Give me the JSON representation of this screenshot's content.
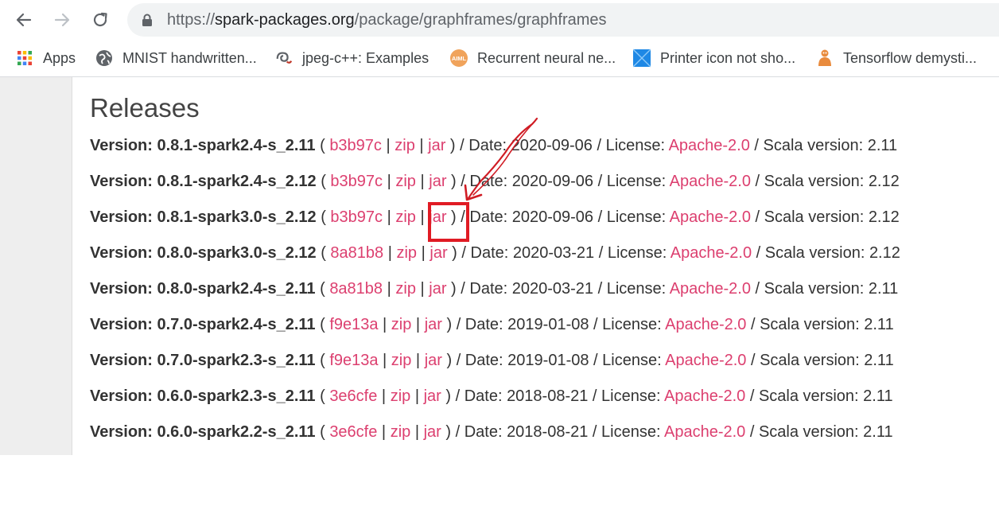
{
  "browser": {
    "url": "https://spark-packages.org/package/graphframes/graphframes",
    "url_scheme": "https://",
    "url_host": "spark-packages.org",
    "url_path": "/package/graphframes/graphframes"
  },
  "bookmarks": [
    {
      "label": "Apps",
      "icon": "apps-grid-icon"
    },
    {
      "label": "MNIST handwritten...",
      "icon": "globe-icon"
    },
    {
      "label": "jpeg-c++: Examples",
      "icon": "spiral-icon"
    },
    {
      "label": "Recurrent neural ne...",
      "icon": "aiml-icon"
    },
    {
      "label": "Printer icon not sho...",
      "icon": "windows-icon"
    },
    {
      "label": "Tensorflow demysti...",
      "icon": "tensorflow-icon"
    }
  ],
  "page": {
    "heading": "Releases",
    "labels": {
      "version_prefix": "Version: ",
      "date_prefix": " / Date: ",
      "license_prefix": " / License: ",
      "scala_prefix": " / Scala version: ",
      "open_paren": " ( ",
      "close_paren": " )",
      "pipe": " | "
    },
    "releases": [
      {
        "version": "0.8.1-spark2.4-s_2.11",
        "commit": "b3b97c",
        "zip": "zip",
        "jar": "jar",
        "date": "2020-09-06",
        "license": "Apache-2.0",
        "scala": "2.11"
      },
      {
        "version": "0.8.1-spark2.4-s_2.12",
        "commit": "b3b97c",
        "zip": "zip",
        "jar": "jar",
        "date": "2020-09-06",
        "license": "Apache-2.0",
        "scala": "2.12"
      },
      {
        "version": "0.8.1-spark3.0-s_2.12",
        "commit": "b3b97c",
        "zip": "zip",
        "jar": "jar",
        "date": "2020-09-06",
        "license": "Apache-2.0",
        "scala": "2.12"
      },
      {
        "version": "0.8.0-spark3.0-s_2.12",
        "commit": "8a81b8",
        "zip": "zip",
        "jar": "jar",
        "date": "2020-03-21",
        "license": "Apache-2.0",
        "scala": "2.12"
      },
      {
        "version": "0.8.0-spark2.4-s_2.11",
        "commit": "8a81b8",
        "zip": "zip",
        "jar": "jar",
        "date": "2020-03-21",
        "license": "Apache-2.0",
        "scala": "2.11"
      },
      {
        "version": "0.7.0-spark2.4-s_2.11",
        "commit": "f9e13a",
        "zip": "zip",
        "jar": "jar",
        "date": "2019-01-08",
        "license": "Apache-2.0",
        "scala": "2.11"
      },
      {
        "version": "0.7.0-spark2.3-s_2.11",
        "commit": "f9e13a",
        "zip": "zip",
        "jar": "jar",
        "date": "2019-01-08",
        "license": "Apache-2.0",
        "scala": "2.11"
      },
      {
        "version": "0.6.0-spark2.3-s_2.11",
        "commit": "3e6cfe",
        "zip": "zip",
        "jar": "jar",
        "date": "2018-08-21",
        "license": "Apache-2.0",
        "scala": "2.11"
      },
      {
        "version": "0.6.0-spark2.2-s_2.11",
        "commit": "3e6cfe",
        "zip": "zip",
        "jar": "jar",
        "date": "2018-08-21",
        "license": "Apache-2.0",
        "scala": "2.11"
      }
    ]
  },
  "colors": {
    "link": "#dc3f6f",
    "annotation": "#e01b24",
    "text": "#333333"
  }
}
